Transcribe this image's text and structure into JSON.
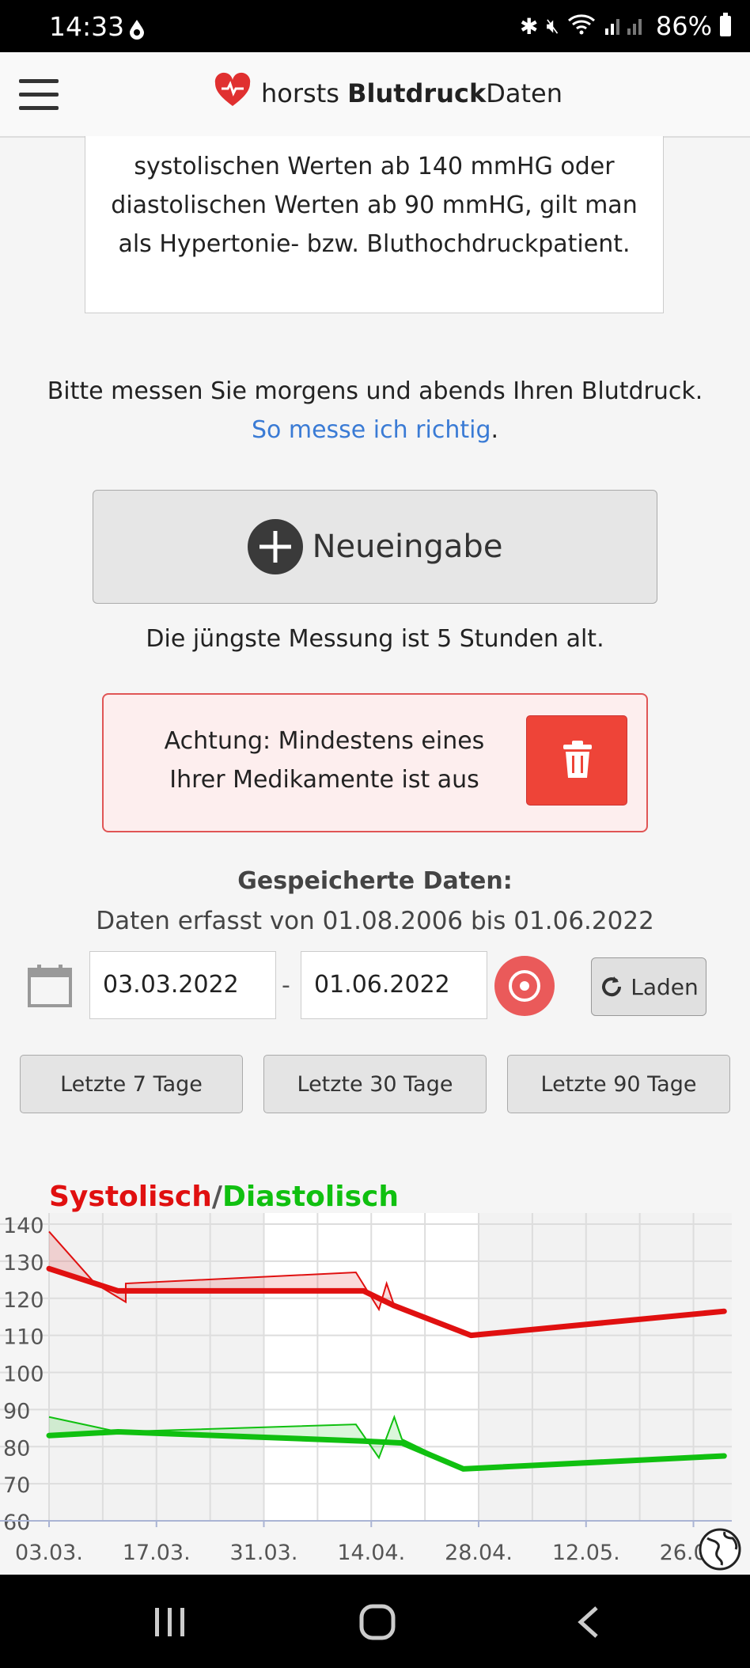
{
  "status_bar": {
    "time": "14:33",
    "battery": "86%"
  },
  "header": {
    "brand_prefix": "horsts ",
    "brand_bold": "Blutdruck",
    "brand_suffix": "Daten"
  },
  "info": {
    "lines": [
      "systolischen Werten ab 140 mmHG oder",
      "diastolischen Werten ab 90 mmHG, gilt man",
      "als Hypertonie- bzw. Bluthochdruckpatient."
    ]
  },
  "measure": {
    "text": "Bitte messen Sie morgens und abends Ihren Blutdruck.",
    "link": "So messe ich richtig",
    "link_suffix": "."
  },
  "new_entry": {
    "label": "Neueingabe"
  },
  "last_measurement": "Die jüngste Messung ist 5 Stunden alt.",
  "alert": {
    "line1": "Achtung: Mindestens eines",
    "line2": "Ihrer Medikamente ist aus",
    "color": "#ee4438"
  },
  "saved": {
    "title": "Gespeicherte Daten:",
    "range": "Daten erfasst von 01.08.2006 bis 01.06.2022"
  },
  "filter": {
    "from": "03.03.2022",
    "separator": "-",
    "to": "01.06.2022",
    "load_label": "Laden"
  },
  "quick_ranges": [
    "Letzte 7 Tage",
    "Letzte 30 Tage",
    "Letzte 90 Tage"
  ],
  "chart_title": {
    "systolic": "Systolisch",
    "slash": "/",
    "diastolic": "Diastolisch"
  },
  "chart_data": {
    "type": "line",
    "x_ticks": [
      "03.03.",
      "17.03.",
      "31.03.",
      "14.04.",
      "28.04.",
      "12.05.",
      "26.05."
    ],
    "y_ticks": [
      60,
      70,
      80,
      90,
      100,
      110,
      120,
      130,
      140
    ],
    "ylim": [
      60,
      143
    ],
    "xlim": [
      "2022-03-03",
      "2022-05-31"
    ],
    "series": [
      {
        "name": "Systolisch",
        "color": "#e01010",
        "trend": [
          [
            "2022-03-03",
            128
          ],
          [
            "2022-03-12",
            122
          ],
          [
            "2022-04-13",
            122
          ],
          [
            "2022-04-17",
            118
          ],
          [
            "2022-04-27",
            110
          ],
          [
            "2022-05-30",
            116.5
          ]
        ],
        "raw": [
          [
            "2022-03-03",
            138
          ],
          [
            "2022-03-09",
            124
          ],
          [
            "2022-03-13",
            119
          ],
          [
            "2022-03-13",
            124
          ],
          [
            "2022-04-12",
            127
          ],
          [
            "2022-04-15",
            117
          ],
          [
            "2022-04-16",
            124
          ],
          [
            "2022-04-17",
            118
          ],
          [
            "2022-04-27",
            110
          ],
          [
            "2022-05-30",
            116.5
          ]
        ]
      },
      {
        "name": "Diastolisch",
        "color": "#10c010",
        "trend": [
          [
            "2022-03-03",
            83
          ],
          [
            "2022-03-12",
            84
          ],
          [
            "2022-04-13",
            81.5
          ],
          [
            "2022-04-18",
            81
          ],
          [
            "2022-04-26",
            74
          ],
          [
            "2022-05-30",
            77.5
          ]
        ],
        "raw": [
          [
            "2022-03-03",
            88
          ],
          [
            "2022-03-12",
            84
          ],
          [
            "2022-04-12",
            86
          ],
          [
            "2022-04-15",
            77
          ],
          [
            "2022-04-17",
            88
          ],
          [
            "2022-04-18",
            82
          ],
          [
            "2022-04-26",
            74
          ],
          [
            "2022-05-30",
            77.5
          ]
        ]
      }
    ]
  }
}
